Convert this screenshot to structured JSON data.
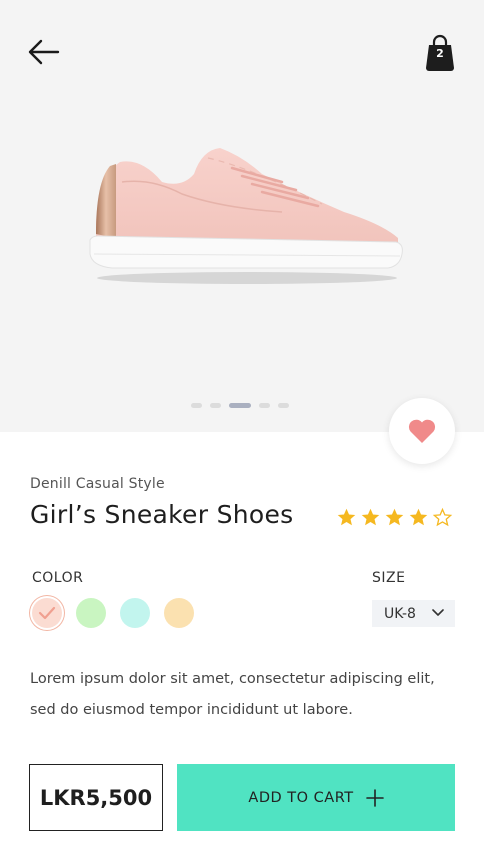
{
  "header": {
    "back_icon": "arrow-left-icon",
    "bag_icon": "shopping-bag-icon",
    "bag_count": "2"
  },
  "carousel": {
    "image": "pink-sneaker-photo",
    "slides_total": 5,
    "active_slide": 3
  },
  "product": {
    "subtitle": "Denill Casual Style",
    "title": "Girl’s Sneaker Shoes",
    "rating": 4,
    "rating_max": 5,
    "favorite_icon": "heart-icon",
    "description": "Lorem ipsum dolor sit amet, consectetur adipiscing elit, sed do eiusmod tempor incididunt ut labore."
  },
  "options": {
    "color_label": "COLOR",
    "colors": [
      "#fbdcd2",
      "#c9f5c1",
      "#c2f5ee",
      "#fbe1b0"
    ],
    "selected_color_index": 0,
    "size_label": "SIZE",
    "size_value": "UK-8"
  },
  "purchase": {
    "price": "LKR5,500",
    "add_to_cart_label": "ADD TO CART"
  },
  "colors": {
    "accent": "#50e3c2",
    "star": "#f5b820",
    "heart": "#f08a8a"
  }
}
